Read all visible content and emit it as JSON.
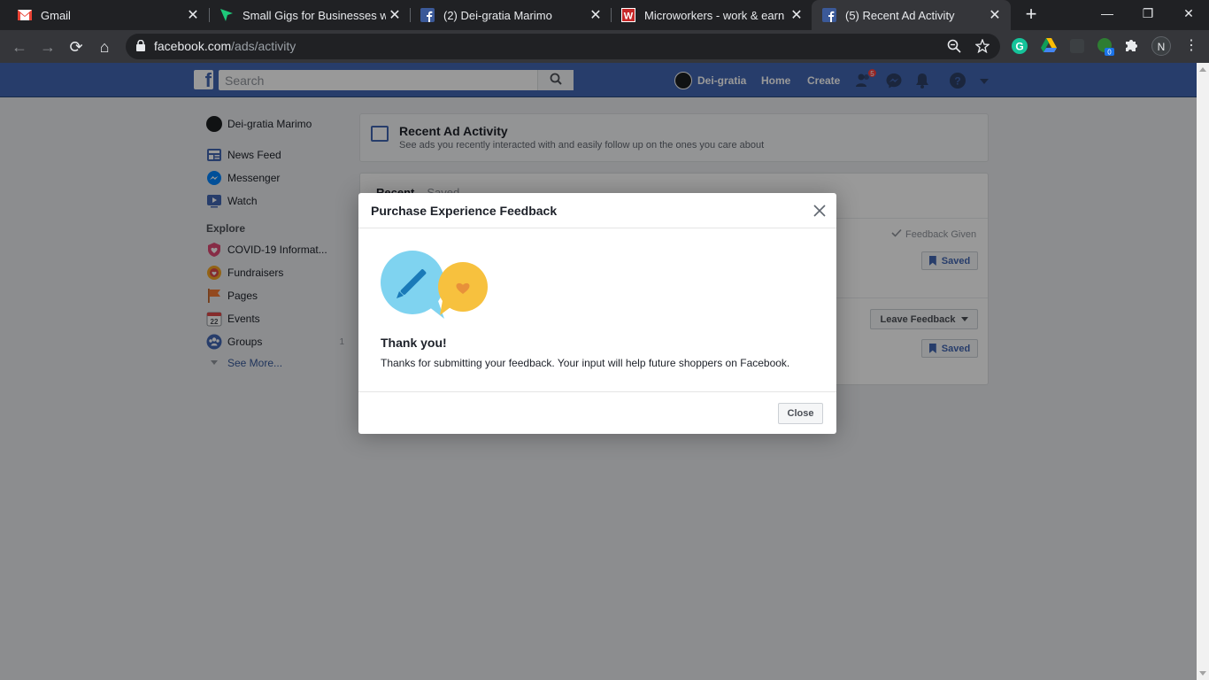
{
  "browser": {
    "tabs": [
      {
        "title": "Gmail",
        "icon": "gmail-icon"
      },
      {
        "title": "Small Gigs for Businesses with",
        "icon": "send-arrow-icon"
      },
      {
        "title": "(2) Dei-gratia Marimo",
        "icon": "facebook-icon"
      },
      {
        "title": "Microworkers - work & earn or",
        "icon": "microworkers-icon"
      },
      {
        "title": "(5) Recent Ad Activity",
        "icon": "facebook-icon",
        "active": true
      }
    ],
    "url_host": "facebook.com",
    "url_path": "/ads/activity",
    "profile_initial": "N",
    "extension_badge": "0"
  },
  "fb": {
    "search_placeholder": "Search",
    "user_name": "Dei-gratia",
    "nav": [
      "Home",
      "Create"
    ],
    "friend_requests_count": "5",
    "brand_color": "#4267b2"
  },
  "left_nav": {
    "profile_name": "Dei-gratia Marimo",
    "items": [
      {
        "label": "News Feed",
        "icon": "news-feed-icon"
      },
      {
        "label": "Messenger",
        "icon": "messenger-icon"
      },
      {
        "label": "Watch",
        "icon": "watch-icon"
      }
    ],
    "explore_heading": "Explore",
    "explore_items": [
      {
        "label": "COVID-19 Informat...",
        "icon": "covid-heart-icon"
      },
      {
        "label": "Fundraisers",
        "icon": "fundraiser-icon"
      },
      {
        "label": "Pages",
        "icon": "flag-icon"
      },
      {
        "label": "Events",
        "icon": "calendar-icon",
        "icon_text": "22"
      },
      {
        "label": "Groups",
        "icon": "groups-icon",
        "count": "1"
      }
    ],
    "see_more": "See More..."
  },
  "ad_activity": {
    "title": "Recent Ad Activity",
    "subtitle": "See ads you recently interacted with and easily follow up on the ones you care about",
    "tab_recent": "Recent",
    "tab_saved": "Saved",
    "feedback_given": "Feedback Given",
    "saved_label": "Saved",
    "leave_feedback": "Leave Feedback"
  },
  "modal": {
    "title": "Purchase Experience Feedback",
    "heading": "Thank you!",
    "body": "Thanks for submitting your feedback. Your input will help future shoppers on Facebook.",
    "close_label": "Close"
  }
}
